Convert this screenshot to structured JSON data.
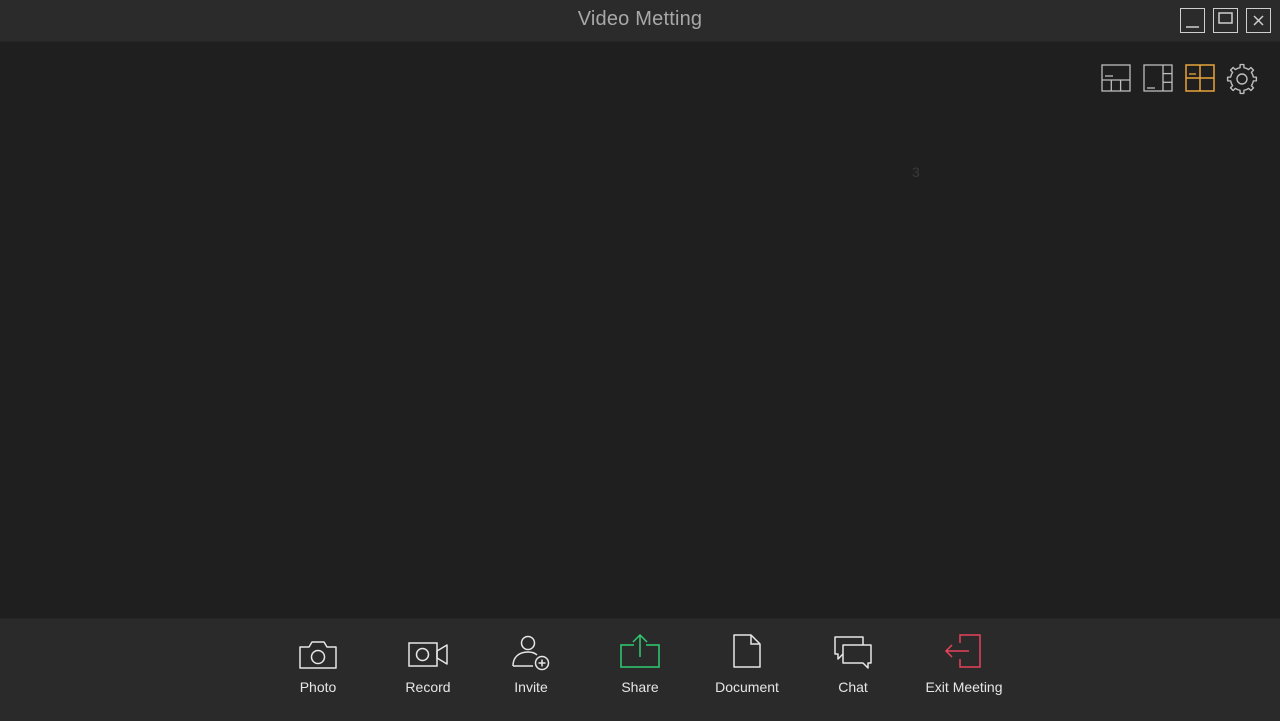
{
  "window": {
    "title": "Video Metting",
    "controls": [
      "minimize-icon",
      "maximize-icon",
      "close-icon"
    ]
  },
  "stage": {
    "layouts": [
      {
        "name": "layout-bottom-strip",
        "active": false
      },
      {
        "name": "layout-side-strip",
        "active": false
      },
      {
        "name": "layout-grid",
        "active": true
      }
    ],
    "settings_icon": "gear-icon",
    "overlay_number": "3"
  },
  "toolbar": {
    "items": [
      {
        "label": "Photo",
        "icon": "camera-icon",
        "color": "#e6e6e6"
      },
      {
        "label": "Record",
        "icon": "video-camera-icon",
        "color": "#e6e6e6"
      },
      {
        "label": "Invite",
        "icon": "add-user-icon",
        "color": "#e6e6e6"
      },
      {
        "label": "Share",
        "icon": "share-icon",
        "color": "#2ecc71"
      },
      {
        "label": "Document",
        "icon": "document-icon",
        "color": "#e6e6e6"
      },
      {
        "label": "Chat",
        "icon": "chat-icon",
        "color": "#e6e6e6"
      },
      {
        "label": "Exit Meeting",
        "icon": "exit-icon",
        "color": "#e8435a"
      }
    ]
  },
  "colors": {
    "active_layout": "#e8a33a",
    "inactive_icon": "#bdbdbd",
    "share": "#2ecc71",
    "exit": "#e8435a"
  }
}
